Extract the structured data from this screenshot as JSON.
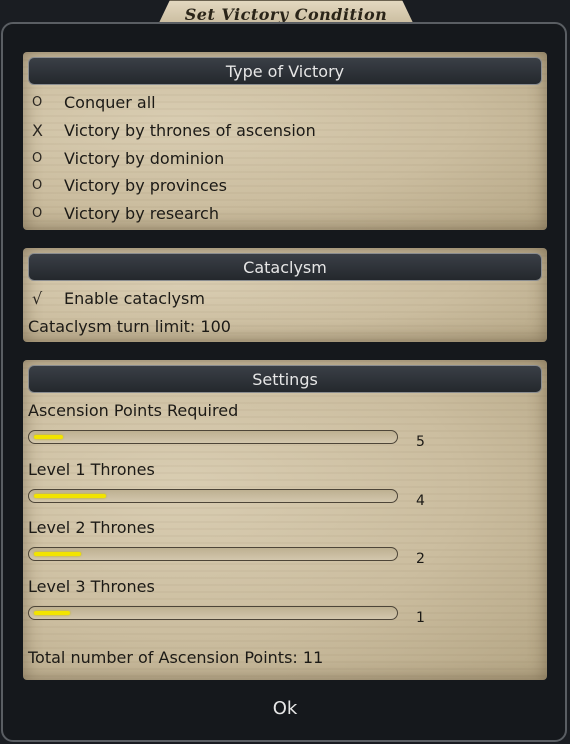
{
  "window": {
    "title": "Set Victory Condition"
  },
  "victory": {
    "header": "Type of Victory",
    "options": [
      {
        "mark": "O",
        "label": "Conquer all"
      },
      {
        "mark": "X",
        "label": "Victory by thrones of ascension"
      },
      {
        "mark": "O",
        "label": "Victory by dominion"
      },
      {
        "mark": "O",
        "label": "Victory by provinces"
      },
      {
        "mark": "O",
        "label": "Victory by research"
      }
    ]
  },
  "cataclysm": {
    "header": "Cataclysm",
    "enable_mark": "√",
    "enable_label": "Enable cataclysm",
    "turn_limit": "Cataclysm turn limit: 100"
  },
  "settings": {
    "header": "Settings",
    "sliders": [
      {
        "label": "Ascension Points Required",
        "value": "5",
        "fill_fraction": 0.08
      },
      {
        "label": "Level 1 Thrones",
        "value": "4",
        "fill_fraction": 0.2
      },
      {
        "label": "Level 2 Thrones",
        "value": "2",
        "fill_fraction": 0.13
      },
      {
        "label": "Level 3 Thrones",
        "value": "1",
        "fill_fraction": 0.1
      }
    ],
    "total": "Total number of Ascension Points: 11"
  },
  "ok_label": "Ok",
  "colors": {
    "slider_fill": "#f2e400",
    "parchment": "#cbbd9f",
    "frame": "#15181c"
  }
}
